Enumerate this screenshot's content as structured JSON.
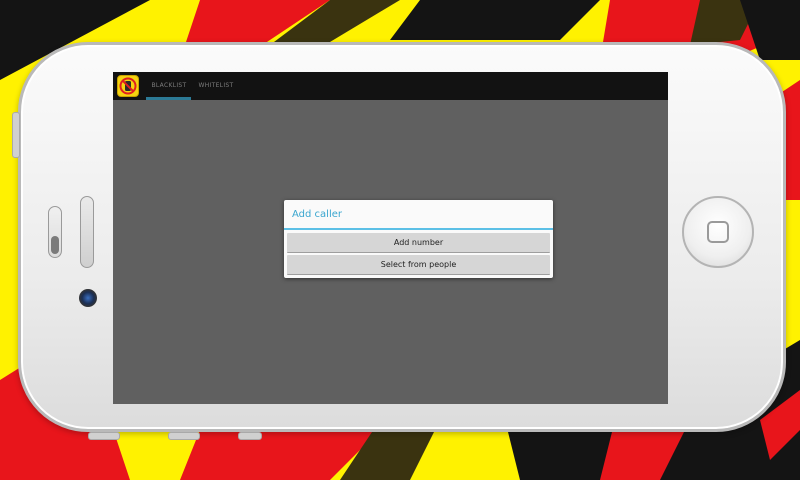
{
  "backdrop": {
    "colors": {
      "yellow": "#FFF200",
      "red": "#E8151B",
      "black": "#141414",
      "olive": "#3A3310"
    }
  },
  "device": {
    "type": "phone",
    "orientation": "landscape",
    "home_button_icon": "home-square-icon"
  },
  "app": {
    "icon": "no-call-icon",
    "tabs": [
      {
        "label": "BLACKLIST",
        "selected": true
      },
      {
        "label": "WHITELIST",
        "selected": false
      }
    ],
    "accent_color": "#33B5E5"
  },
  "dialog": {
    "title": "Add caller",
    "buttons": [
      "Add number",
      "Select from people"
    ]
  }
}
